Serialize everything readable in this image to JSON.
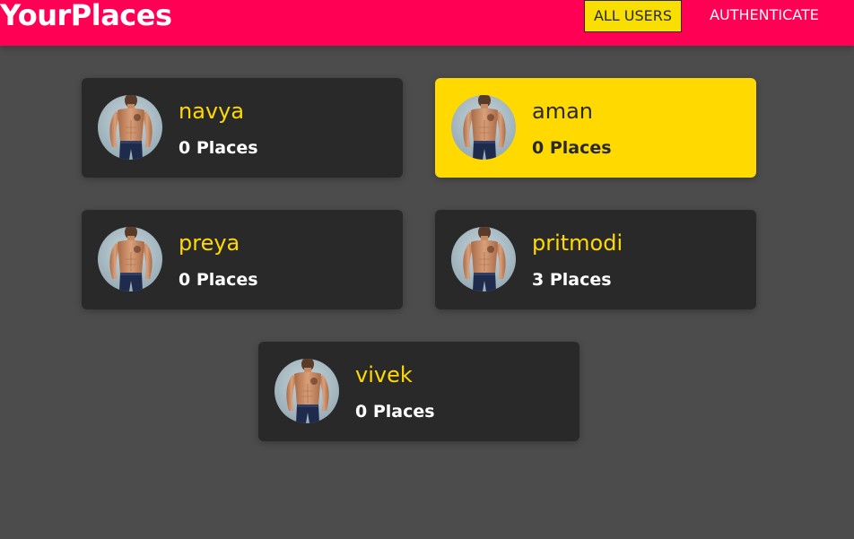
{
  "header": {
    "brand": "YourPlaces",
    "nav": [
      {
        "label": "ALL USERS",
        "active": true
      },
      {
        "label": "AUTHENTICATE",
        "active": false
      }
    ]
  },
  "users": [
    {
      "name": "navya",
      "places": "0 Places",
      "active": false
    },
    {
      "name": "aman",
      "places": "0 Places",
      "active": true
    },
    {
      "name": "preya",
      "places": "0 Places",
      "active": false
    },
    {
      "name": "pritmodi",
      "places": "3 Places",
      "active": false
    },
    {
      "name": "vivek",
      "places": "0 Places",
      "active": false
    }
  ],
  "colors": {
    "header": "#ff0055",
    "background": "#4c4c4c",
    "card": "#292929",
    "accent": "#ffd900"
  },
  "icons": {
    "avatar": "user-photo-avatar"
  }
}
